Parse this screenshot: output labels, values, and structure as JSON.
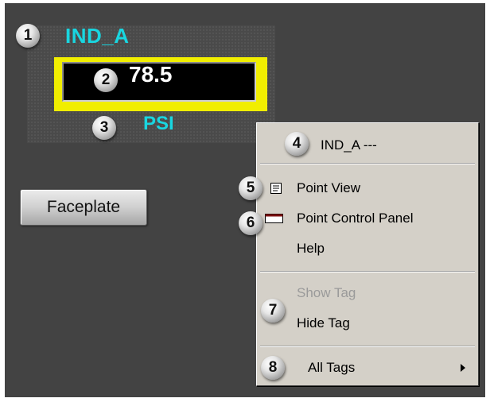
{
  "tag": {
    "name": "IND_A",
    "value": "78.5",
    "unit": "PSI"
  },
  "faceplate": {
    "label": "Faceplate"
  },
  "callouts": [
    "1",
    "2",
    "3",
    "4",
    "5",
    "6",
    "7",
    "8"
  ],
  "context_menu": {
    "header": "IND_A ---",
    "items": [
      {
        "label": "Point View",
        "icon": "point-view-icon",
        "enabled": true
      },
      {
        "label": "Point Control Panel",
        "icon": "control-panel-icon",
        "enabled": true
      },
      {
        "label": "Help",
        "enabled": true
      },
      {
        "label": "Show Tag",
        "enabled": false
      },
      {
        "label": "Hide Tag",
        "enabled": true
      },
      {
        "label": "All Tags",
        "has_submenu": true,
        "enabled": true
      }
    ]
  },
  "colors": {
    "background": "#434343",
    "tag_text": "#19d6e0",
    "value_frame": "#f1ee00",
    "menu_bg": "#d4d0c8",
    "disabled_text": "#9a9a9a"
  }
}
